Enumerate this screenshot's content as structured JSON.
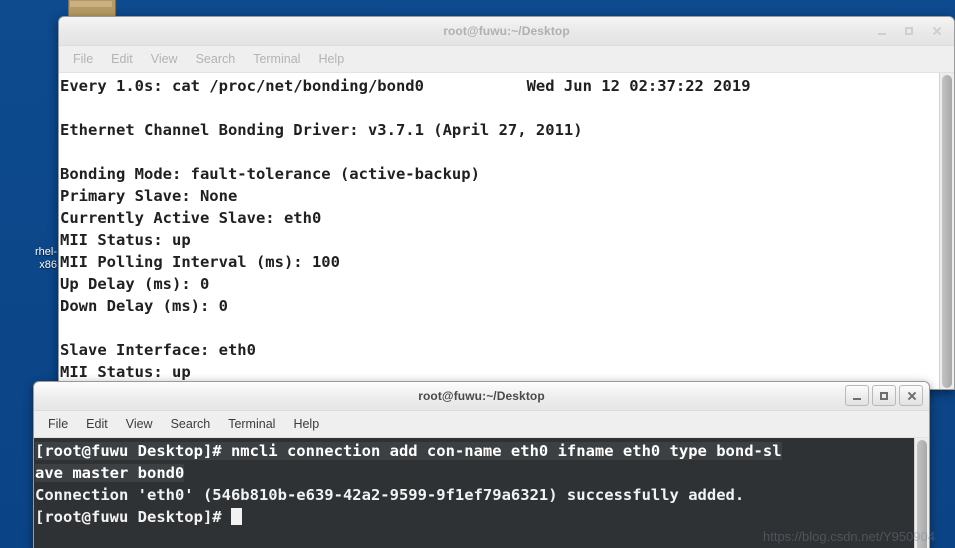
{
  "desktop": {
    "background_color": "#0d4b8f",
    "icons": [
      {
        "name": "folder",
        "label": ""
      },
      {
        "name": "rhel-iso",
        "label_line1": "rhel-",
        "label_line2": "x86"
      }
    ]
  },
  "windows": [
    {
      "id": "watch-bond0",
      "title": "root@fuwu:~/Desktop",
      "active": false,
      "menu": [
        "File",
        "Edit",
        "View",
        "Search",
        "Terminal",
        "Help"
      ],
      "controls": {
        "minimize": "minimize-button",
        "maximize": "maximize-button",
        "close": "close-button"
      },
      "theme": "light",
      "lines": [
        {
          "left": "Every 1.0s: cat /proc/net/bonding/bond0",
          "right": "Wed Jun 12 02:37:22 2019"
        },
        {
          "left": ""
        },
        {
          "left": "Ethernet Channel Bonding Driver: v3.7.1 (April 27, 2011)"
        },
        {
          "left": ""
        },
        {
          "left": "Bonding Mode: fault-tolerance (active-backup)"
        },
        {
          "left": "Primary Slave: None"
        },
        {
          "left": "Currently Active Slave: eth0"
        },
        {
          "left": "MII Status: up"
        },
        {
          "left": "MII Polling Interval (ms): 100"
        },
        {
          "left": "Up Delay (ms): 0"
        },
        {
          "left": "Down Delay (ms): 0"
        },
        {
          "left": ""
        },
        {
          "left": "Slave Interface: eth0"
        },
        {
          "left": "MII Status: up"
        }
      ]
    },
    {
      "id": "nmcli",
      "title": "root@fuwu:~/Desktop",
      "active": true,
      "menu": [
        "File",
        "Edit",
        "View",
        "Search",
        "Terminal",
        "Help"
      ],
      "controls": {
        "minimize": "minimize-button",
        "maximize": "maximize-button",
        "close": "close-button"
      },
      "theme": "dark",
      "lines": [
        {
          "text": "[root@fuwu Desktop]# nmcli connection add con-name eth0 ifname eth0 type bond-sl",
          "selected": true
        },
        {
          "text": "ave master bond0",
          "selected": true
        },
        {
          "text": "Connection 'eth0' (546b810b-e639-42a2-9599-9f1ef79a6321) successfully added.",
          "selected": false
        },
        {
          "text": "[root@fuwu Desktop]# ",
          "selected": false,
          "cursor": true
        }
      ]
    }
  ],
  "watermark": "https://blog.csdn.net/Y950904"
}
